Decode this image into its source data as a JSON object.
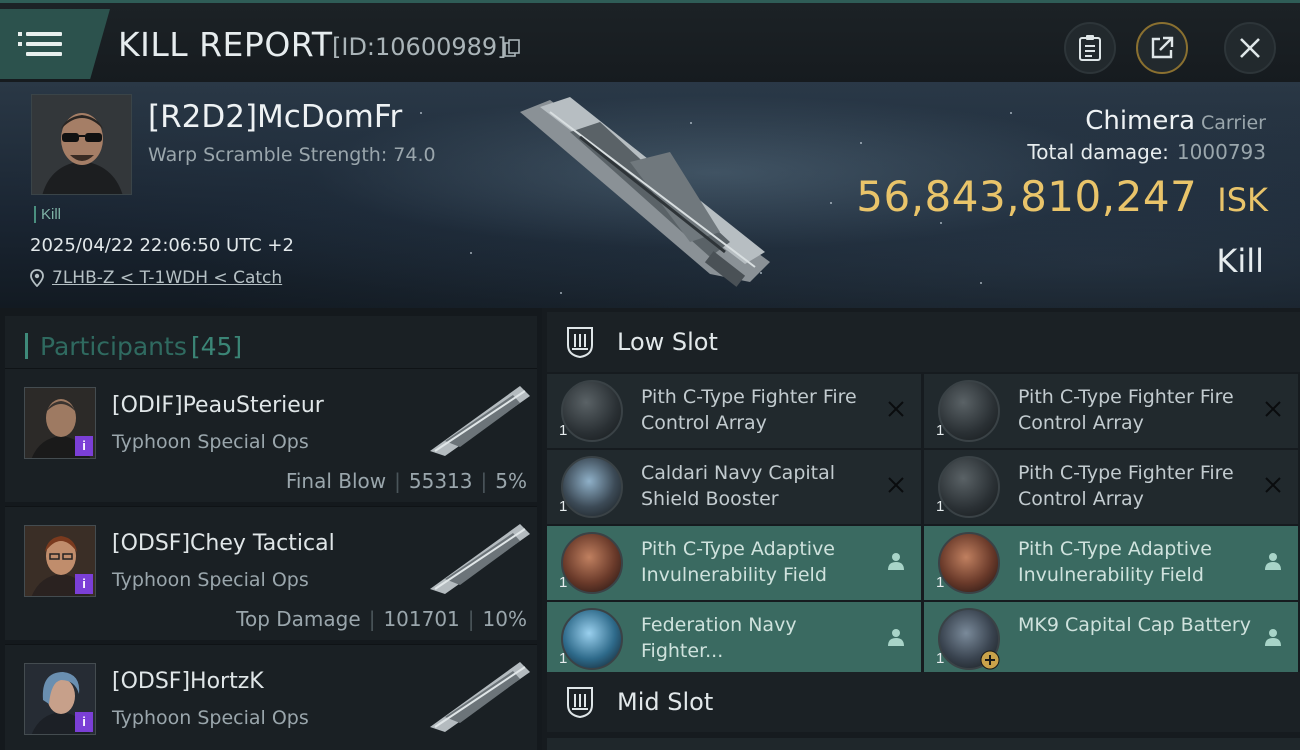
{
  "header": {
    "title": "KILL REPORT",
    "report_id": "[ID:10600989]"
  },
  "victim": {
    "name": "[R2D2]McDomFr",
    "warp_scramble": "Warp Scramble Strength: 74.0",
    "tag": "Kill",
    "date": "2025/04/22 22:06:50 UTC +2",
    "location": "7LHB-Z < T-1WDH < Catch"
  },
  "ship": {
    "name": "Chimera",
    "class": "Carrier",
    "damage_label": "Total damage:",
    "damage_value": "1000793",
    "isk_value": "56,843,810,247",
    "isk_unit": "ISK",
    "result": "Kill"
  },
  "participants": {
    "label": "Participants",
    "count": "[45]",
    "items": [
      {
        "name": "[ODIF]PeauSterieur",
        "ship": "Typhoon Special Ops",
        "role": "Final Blow",
        "damage": "55313",
        "percent": "5%"
      },
      {
        "name": "[ODSF]Chey Tactical",
        "ship": "Typhoon Special Ops",
        "role": "Top Damage",
        "damage": "101701",
        "percent": "10%"
      },
      {
        "name": "[ODSF]HortzK",
        "ship": "Typhoon Special Ops",
        "role": "",
        "damage": "",
        "percent": ""
      }
    ],
    "badge": "i"
  },
  "slots": {
    "low_slot_label": "Low Slot",
    "mid_slot_label": "Mid Slot",
    "low": [
      {
        "name": "Pith C-Type Fighter Fire Control Array",
        "qty": "1",
        "status": "destroyed"
      },
      {
        "name": "Pith C-Type Fighter Fire Control Array",
        "qty": "1",
        "status": "destroyed"
      },
      {
        "name": "Caldari Navy Capital Shield Booster",
        "qty": "1",
        "status": "destroyed"
      },
      {
        "name": "Pith C-Type Fighter Fire Control Array",
        "qty": "1",
        "status": "destroyed"
      },
      {
        "name": "Pith C-Type Adaptive Invulnerability Field",
        "qty": "1",
        "status": "dropped"
      },
      {
        "name": "Pith C-Type Adaptive Invulnerability Field",
        "qty": "1",
        "status": "dropped"
      },
      {
        "name": "Federation Navy Fighter...",
        "qty": "1",
        "status": "dropped"
      },
      {
        "name": "MK9 Capital Cap Battery",
        "qty": "1",
        "status": "dropped"
      }
    ]
  },
  "colors": {
    "accent": "#3a6a61",
    "isk": "#e9c46a",
    "badge": "#7b3fd6"
  }
}
